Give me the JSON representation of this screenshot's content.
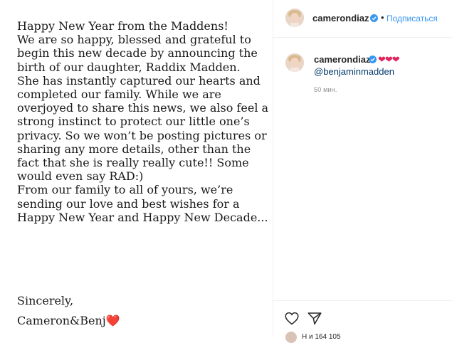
{
  "post": {
    "body": "Happy New Year from the Maddens!\nWe are so happy, blessed and grateful to begin this new decade by announcing the birth of our daughter, Raddix Madden.\nShe has instantly captured our hearts and completed our family. While we are overjoyed to share this news, we also feel a strong instinct to protect our little one’s privacy. So we won’t be posting pictures or sharing any more details, other than the fact that she is really really cute!! Some would even say RAD:)\nFrom our family to all of yours, we’re sending our love and best wishes for a Happy New Year and Happy New Decade...",
    "closing": "Sincerely,",
    "signature": "Cameron&Benj",
    "signature_emoji": "❤️"
  },
  "header": {
    "username": "camerondiaz",
    "dot": "•",
    "follow_label": "Подписаться",
    "verified_icon": "verified-badge-icon"
  },
  "caption": {
    "username": "camerondiaz",
    "hearts": "❤❤❤",
    "mention": "@benjaminmadden",
    "time": "50 мин."
  },
  "actions": {
    "like_icon": "heart-outline-icon",
    "share_icon": "paper-plane-icon"
  },
  "likes": {
    "partial_text": "Н                              и 164 105"
  },
  "colors": {
    "link_blue": "#3897f0",
    "mention_blue": "#00376b",
    "heart_red": "#e0245e",
    "muted": "#8e8e8e"
  }
}
